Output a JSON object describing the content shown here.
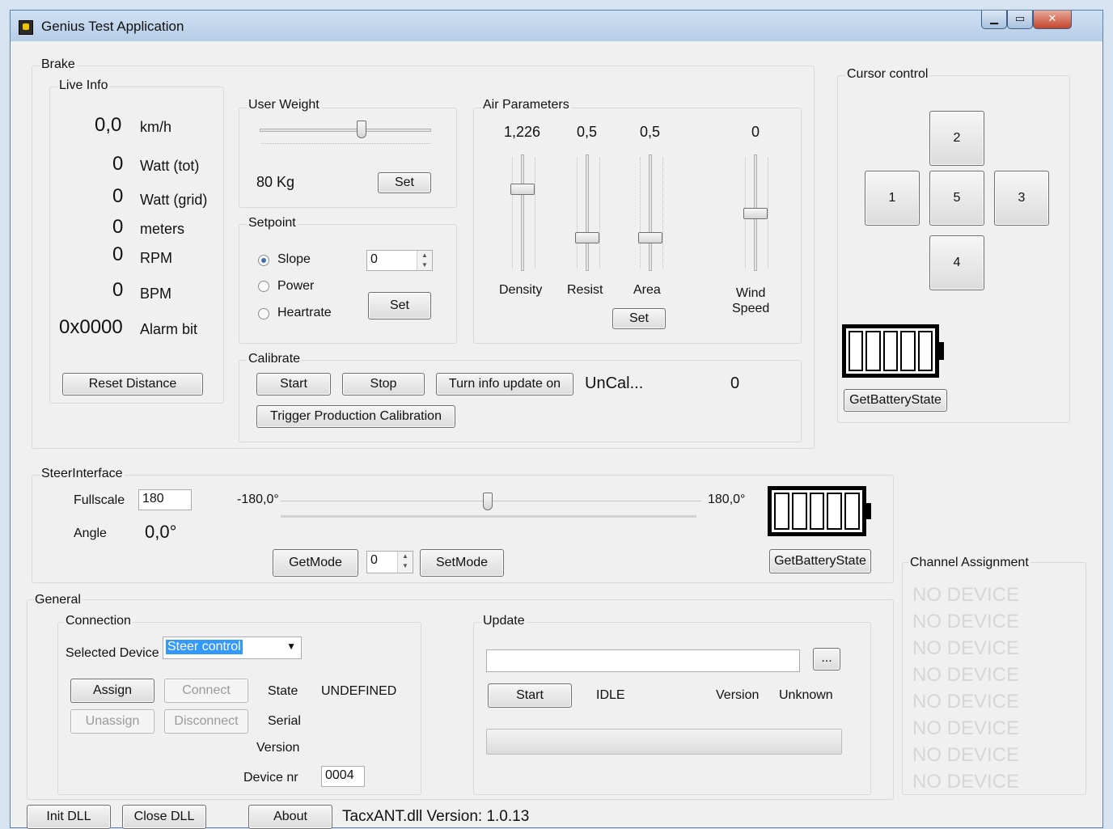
{
  "window": {
    "title": "Genius Test Application",
    "minimize": "▁",
    "maximize": "▭",
    "close": "✕"
  },
  "brake": {
    "label": "Brake",
    "live_info": {
      "label": "Live Info",
      "rows": [
        {
          "value": "0,0",
          "unit": "km/h"
        },
        {
          "value": "0",
          "unit": "Watt (tot)"
        },
        {
          "value": "0",
          "unit": "Watt (grid)"
        },
        {
          "value": "0",
          "unit": "meters"
        },
        {
          "value": "0",
          "unit": "RPM"
        },
        {
          "value": "0",
          "unit": "BPM"
        },
        {
          "value": "0x0000",
          "unit": "Alarm bit"
        }
      ],
      "reset_button": "Reset Distance"
    },
    "user_weight": {
      "label": "User Weight",
      "value": "80 Kg",
      "set_button": "Set"
    },
    "setpoint": {
      "label": "Setpoint",
      "options": [
        "Slope",
        "Power",
        "Heartrate"
      ],
      "selected": "Slope",
      "value": "0",
      "set_button": "Set"
    },
    "air_parameters": {
      "label": "Air Parameters",
      "params": [
        {
          "value": "1,226",
          "label": "Density"
        },
        {
          "value": "0,5",
          "label": "Resist"
        },
        {
          "value": "0,5",
          "label": "Area"
        },
        {
          "value": "0",
          "label": "Wind\nSpeed"
        }
      ],
      "set_button": "Set"
    },
    "calibrate": {
      "label": "Calibrate",
      "start_button": "Start",
      "stop_button": "Stop",
      "turn_info_button": "Turn info update on",
      "status": "UnCal...",
      "value": "0",
      "trigger_button": "Trigger Production Calibration"
    }
  },
  "cursor_control": {
    "label": "Cursor control",
    "buttons": [
      "2",
      "1",
      "5",
      "3",
      "4"
    ],
    "battery_button": "GetBatteryState"
  },
  "steer_interface": {
    "label": "SteerInterface",
    "fullscale_label": "Fullscale",
    "fullscale_value": "180",
    "angle_label": "Angle",
    "angle_value": "0,0°",
    "min_label": "-180,0°",
    "max_label": "180,0°",
    "get_mode_button": "GetMode",
    "mode_value": "0",
    "set_mode_button": "SetMode",
    "battery_button": "GetBatteryState"
  },
  "general": {
    "label": "General",
    "connection": {
      "label": "Connection",
      "selected_device_label": "Selected Device",
      "selected_device_value": "Steer control",
      "assign_button": "Assign",
      "connect_button": "Connect",
      "unassign_button": "Unassign",
      "disconnect_button": "Disconnect",
      "state_label": "State",
      "state_value": "UNDEFINED",
      "serial_label": "Serial",
      "version_label": "Version",
      "device_nr_label": "Device nr",
      "device_nr_value": "0004"
    },
    "update": {
      "label": "Update",
      "browse_button": "...",
      "start_button": "Start",
      "status": "IDLE",
      "version_label": "Version",
      "version_value": "Unknown"
    }
  },
  "channel_assignment": {
    "label": "Channel Assignment",
    "entries": [
      "NO DEVICE",
      "NO DEVICE",
      "NO DEVICE",
      "NO DEVICE",
      "NO DEVICE",
      "NO DEVICE",
      "NO DEVICE",
      "NO DEVICE"
    ]
  },
  "footer": {
    "init_button": "Init DLL",
    "close_button": "Close DLL",
    "about_button": "About",
    "dll_version": "TacxANT.dll Version: 1.0.13"
  }
}
